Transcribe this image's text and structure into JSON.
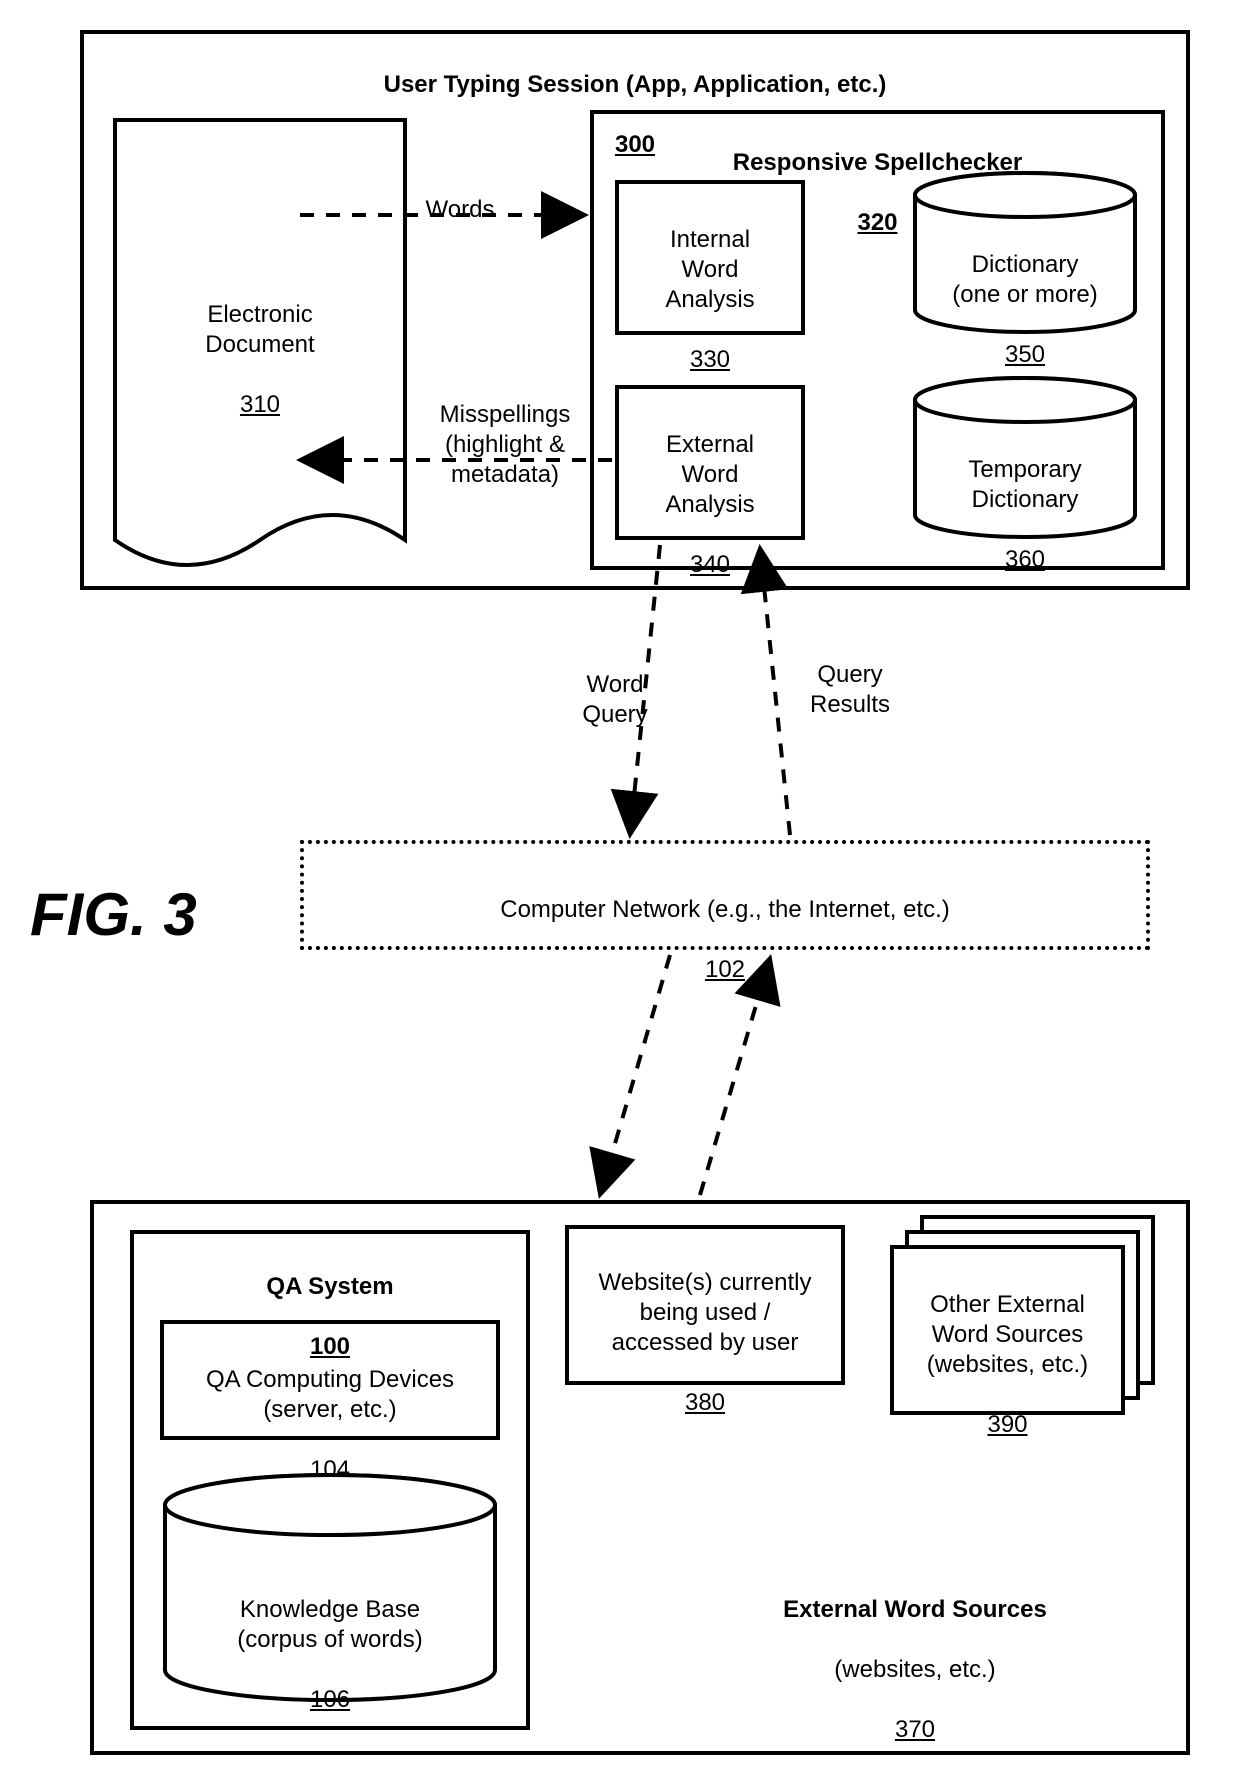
{
  "figure_label": "FIG. 3",
  "session": {
    "title": "User Typing Session (App, Application, etc.)",
    "ref": "300",
    "doc": {
      "title": "Electronic\nDocument",
      "ref": "310"
    },
    "spellchecker": {
      "title": "Responsive Spellchecker",
      "ref": "320",
      "internal": {
        "title": "Internal\nWord\nAnalysis",
        "ref": "330"
      },
      "external": {
        "title": "External\nWord\nAnalysis",
        "ref": "340"
      },
      "dict": {
        "title": "Dictionary\n(one or more)",
        "ref": "350"
      },
      "temp": {
        "title": "Temporary\nDictionary",
        "ref": "360"
      }
    },
    "arrow_words": "Words",
    "arrow_miss": "Misspellings\n(highlight &\nmetadata)",
    "arrow_query": "Word\nQuery",
    "arrow_results": "Query\nResults"
  },
  "network": {
    "title": "Computer Network (e.g., the Internet, etc.)",
    "ref": "102"
  },
  "external": {
    "title": "External Word Sources",
    "sub": "(websites, etc.)",
    "ref": "370",
    "qa": {
      "title": "QA System",
      "ref": "100",
      "comp": {
        "title": "QA Computing Devices\n(server, etc.)",
        "ref": "104"
      },
      "kb": {
        "title": "Knowledge Base\n(corpus of words)",
        "ref": "106"
      }
    },
    "websites": {
      "title": "Website(s) currently\nbeing used /\naccessed by user",
      "ref": "380"
    },
    "other": {
      "title": "Other External\nWord Sources\n(websites, etc.)",
      "ref": "390"
    }
  }
}
